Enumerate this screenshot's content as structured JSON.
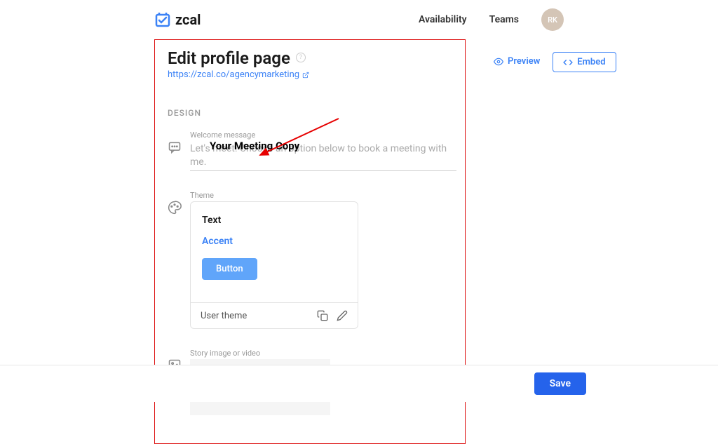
{
  "header": {
    "logo_text": "zcal",
    "nav": {
      "availability": "Availability",
      "teams": "Teams"
    },
    "avatar_initials": "RK"
  },
  "page": {
    "title": "Edit profile page",
    "url": "https://zcal.co/agencymarketing"
  },
  "sidebar": {
    "preview_label": "Preview",
    "embed_label": "Embed"
  },
  "design": {
    "section_label": "DESIGN",
    "welcome": {
      "label": "Welcome message",
      "placeholder": "Let's meet! Choose an option below to book a meeting with me.",
      "overlay": "Your Meeting Copy"
    },
    "theme": {
      "label": "Theme",
      "preview_text": "Text",
      "preview_accent": "Accent",
      "preview_button": "Button",
      "name": "User theme"
    },
    "story": {
      "label": "Story image or video"
    }
  },
  "footer": {
    "save_label": "Save"
  }
}
